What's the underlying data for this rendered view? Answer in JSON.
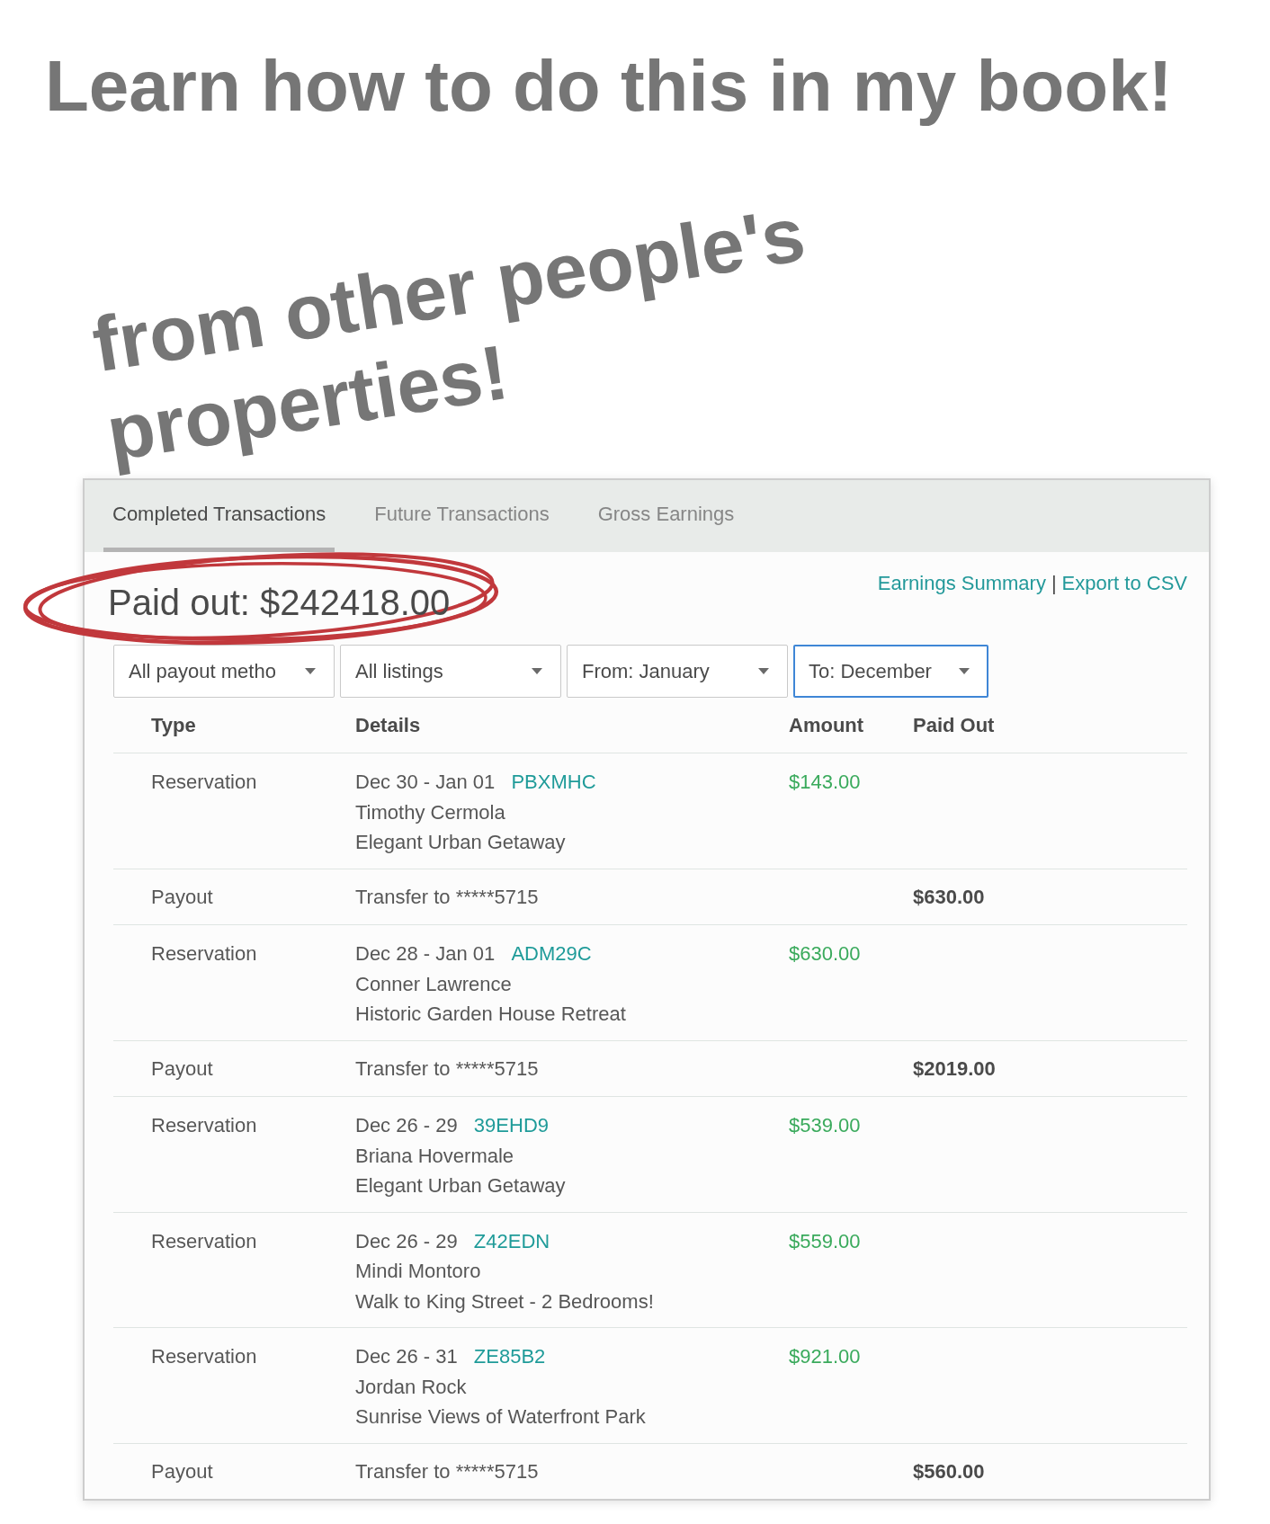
{
  "headline": "Learn how to do this in my book!",
  "subheadline": "from other people's properties!",
  "panel": {
    "tabs": [
      {
        "label": "Completed Transactions",
        "selected": true
      },
      {
        "label": "Future Transactions",
        "selected": false
      },
      {
        "label": "Gross Earnings",
        "selected": false
      }
    ],
    "paid_out": {
      "text": "Paid out: $242418.00",
      "circled": true
    },
    "links": [
      "Earnings Summary",
      "Export to CSV"
    ],
    "link_separator": "|",
    "filters": [
      {
        "value": "All payout metho",
        "focused": false
      },
      {
        "value": "All listings",
        "focused": false
      },
      {
        "value": "From: January",
        "focused": false
      },
      {
        "value": "To: December",
        "focused": true
      }
    ],
    "table": {
      "columns": [
        "Type",
        "Details",
        "Amount",
        "Paid Out"
      ],
      "rows": [
        {
          "kind": "reservation",
          "type": "Reservation",
          "dates": "Dec 30 - Jan 01",
          "code": "PBXMHC",
          "guest": "Timothy Cermola",
          "listing": "Elegant Urban Getaway",
          "amount": "$143.00"
        },
        {
          "kind": "payout",
          "type": "Payout",
          "details": "Transfer to *****5715",
          "paid_out": "$630.00"
        },
        {
          "kind": "reservation",
          "type": "Reservation",
          "dates": "Dec 28 - Jan 01",
          "code": "ADM29C",
          "guest": "Conner Lawrence",
          "listing": "Historic Garden House Retreat",
          "amount": "$630.00"
        },
        {
          "kind": "payout",
          "type": "Payout",
          "details": "Transfer to *****5715",
          "paid_out": "$2019.00"
        },
        {
          "kind": "reservation",
          "type": "Reservation",
          "dates": "Dec 26 - 29",
          "code": "39EHD9",
          "guest": "Briana Hovermale",
          "listing": "Elegant Urban Getaway",
          "amount": "$539.00"
        },
        {
          "kind": "reservation",
          "type": "Reservation",
          "dates": "Dec 26 - 29",
          "code": "Z42EDN",
          "guest": "Mindi Montoro",
          "listing": "Walk to King Street - 2 Bedrooms!",
          "amount": "$559.00"
        },
        {
          "kind": "reservation",
          "type": "Reservation",
          "dates": "Dec 26 - 31",
          "code": "ZE85B2",
          "guest": "Jordan Rock",
          "listing": "Sunrise Views of Waterfront Park",
          "amount": "$921.00"
        },
        {
          "kind": "payout",
          "type": "Payout",
          "details": "Transfer to *****5715",
          "paid_out": "$560.00"
        }
      ]
    }
  }
}
